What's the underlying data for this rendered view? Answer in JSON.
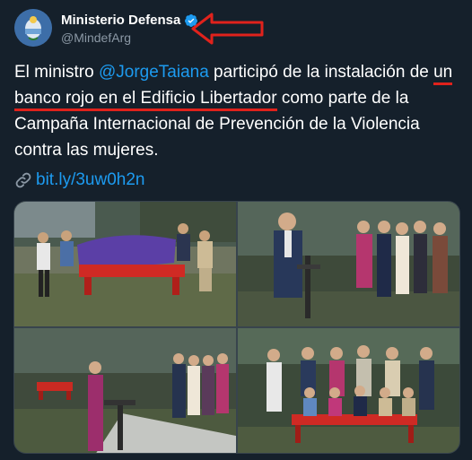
{
  "tweet": {
    "author": {
      "display_name": "Ministerio Defensa",
      "handle": "@MindefArg",
      "verified": true,
      "avatar_icon": "coat-of-arms-icon"
    },
    "text": {
      "part1": "El ministro ",
      "mention": "@JorgeTaiana",
      "part2": " participó de la instalación de ",
      "highlight": "un banco rojo en el Edificio Libertador",
      "part3": " como parte de la Campaña Internacional de Prevención de la Violencia contra las mujeres."
    },
    "link": {
      "icon": "link-icon",
      "text": "bit.ly/3uw0h2n"
    },
    "media": {
      "photo_count": 4
    }
  },
  "annotation": {
    "arrow_color": "#e0221c",
    "underline_color": "#e0221c"
  },
  "colors": {
    "background": "#15202b",
    "accent": "#1d9bf0",
    "secondary_text": "#8b98a5"
  }
}
